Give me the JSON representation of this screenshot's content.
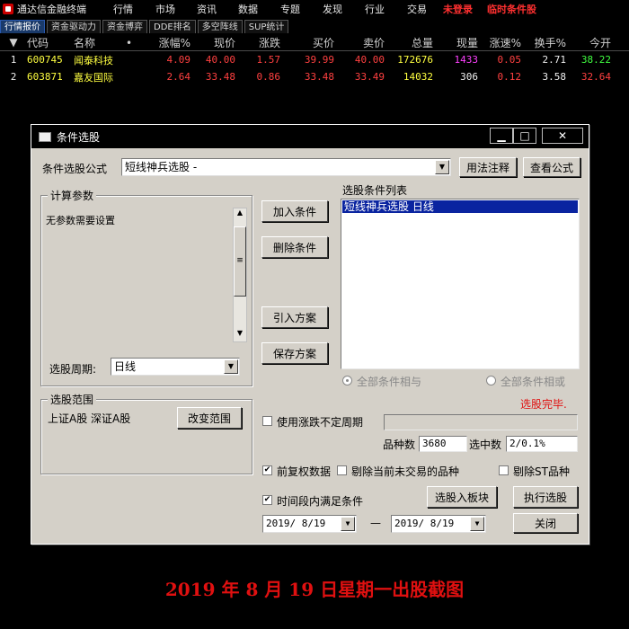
{
  "menubar": {
    "app_title": "通达信金融终端",
    "items": [
      "行情",
      "市场",
      "资讯",
      "数据",
      "专题",
      "发现",
      "行业",
      "交易"
    ],
    "red_items": [
      "未登录",
      "临时条件股"
    ]
  },
  "tabs": [
    "行情报价",
    "资金驱动力",
    "资金博弈",
    "DDE排名",
    "多空阵线",
    "SUP统计"
  ],
  "stock_table": {
    "headers": [
      "",
      "代码",
      "名称",
      "•",
      "涨幅%",
      "现价",
      "涨跌",
      "买价",
      "卖价",
      "总量",
      "现量",
      "涨速%",
      "换手%",
      "今开"
    ],
    "rows": [
      {
        "idx": "1",
        "code": "600745",
        "name": "闻泰科技",
        "pct": "4.09",
        "price": "40.00",
        "chg": "1.57",
        "bid": "39.99",
        "ask": "40.00",
        "vol": "172676",
        "cur": "1433",
        "speed": "0.05",
        "turn": "2.71",
        "open": "38.22"
      },
      {
        "idx": "2",
        "code": "603871",
        "name": "嘉友国际",
        "pct": "2.64",
        "price": "33.48",
        "chg": "0.86",
        "bid": "33.48",
        "ask": "33.49",
        "vol": "14032",
        "cur": "306",
        "speed": "0.12",
        "turn": "3.58",
        "open": "32.64"
      }
    ]
  },
  "dialog": {
    "title": "条件选股",
    "formula_label": "条件选股公式",
    "formula_value": "短线神兵选股 -",
    "usage_button": "用法注释",
    "view_formula_button": "查看公式",
    "params_group": "计算参数",
    "params_text": "无参数需要设置",
    "period_label": "选股周期:",
    "period_value": "日线",
    "add_button": "加入条件",
    "delete_button": "删除条件",
    "import_button": "引入方案",
    "save_button": "保存方案",
    "condition_list_label": "选股条件列表",
    "condition_item": "短线神兵选股  日线",
    "radio_all_and": "全部条件相与",
    "radio_all_or": "全部条件相或",
    "status_text": "选股完毕.",
    "range_group": "选股范围",
    "range_text": "上证A股  深证A股",
    "change_range_button": "改变范围",
    "use_period_label": "使用涨跌不定周期",
    "count_label": "品种数",
    "count_value": "3680",
    "hit_label": "选中数",
    "hit_value": "2/0.1%",
    "adjust_label": "前复权数据",
    "exclude_untraded_label": "剔除当前未交易的品种",
    "exclude_st_label": "剔除ST品种",
    "time_range_label": "时间段内满足条件",
    "to_board_button": "选股入板块",
    "execute_button": "执行选股",
    "close_button": "关闭",
    "date_from": "2019/ 8/19",
    "date_sep": "—",
    "date_to": "2019/ 8/19"
  },
  "footer_caption": "2019 年 8 月 19 日星期一出股截图",
  "colors": {
    "up": "#ff4040",
    "yellow": "#ffff40",
    "magenta": "#ff40ff",
    "green": "#40ff40",
    "selection": "#0a24a0",
    "footer": "#e01010"
  }
}
